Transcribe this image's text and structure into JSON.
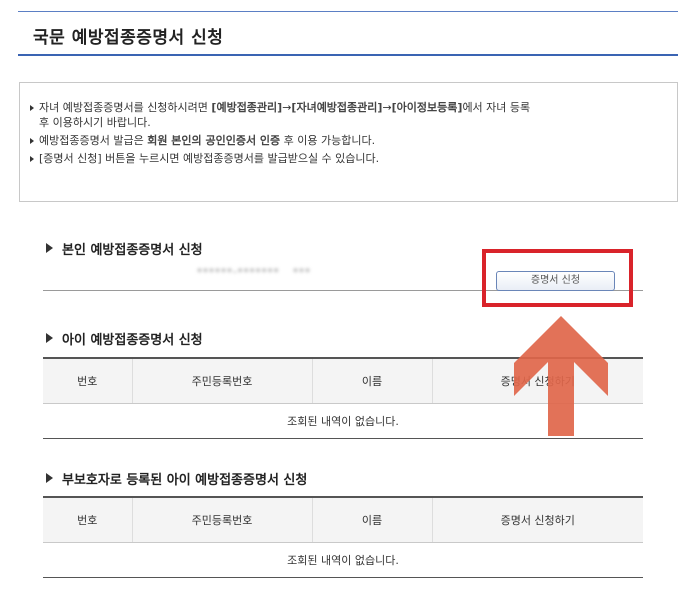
{
  "page": {
    "title": "국문 예방접종증명서 신청"
  },
  "notice": {
    "line1_a": "자녀 예방접종증명서를 신청하시려면 ",
    "line1_link1": "[예방접종관리]",
    "line1_b": "→",
    "line1_link2": "[자녀예방접종관리]",
    "line1_c": "→",
    "line1_link3": "[아이정보등록]",
    "line1_d": "에서 자녀 등록",
    "line1_e": "후 이용하시기 바랍니다.",
    "line2_a": "예방접종증명서 발급은 ",
    "line2_hl": "회원 본인의 공인인증서 인증",
    "line2_b": " 후 이용 가능합니다.",
    "line3": "[증명서 신청] 버튼을 누르시면 예방접종증명서를 발급받으실 수 있습니다."
  },
  "self_section": {
    "title": "본인 예방접종증명서 신청",
    "masked_id": "******-*******",
    "masked_name": "***",
    "apply_button": "증명서 신청"
  },
  "child_section": {
    "title": "아이 예방접종증명서 신청",
    "columns": [
      "번호",
      "주민등록번호",
      "이름",
      "증명서 신청하기"
    ],
    "empty_message": "조회된 내역이 없습니다."
  },
  "guardian_section": {
    "title": "부보호자로 등록된 아이 예방접종증명서 신청",
    "columns": [
      "번호",
      "주민등록번호",
      "이름",
      "증명서 신청하기"
    ],
    "empty_message": "조회된 내역이 없습니다."
  },
  "colors": {
    "highlight": "#d9232a",
    "arrow": "#e0664a",
    "title_rule": "#3a64b3"
  },
  "icons": {
    "pointer": "arrow-up-icon"
  }
}
